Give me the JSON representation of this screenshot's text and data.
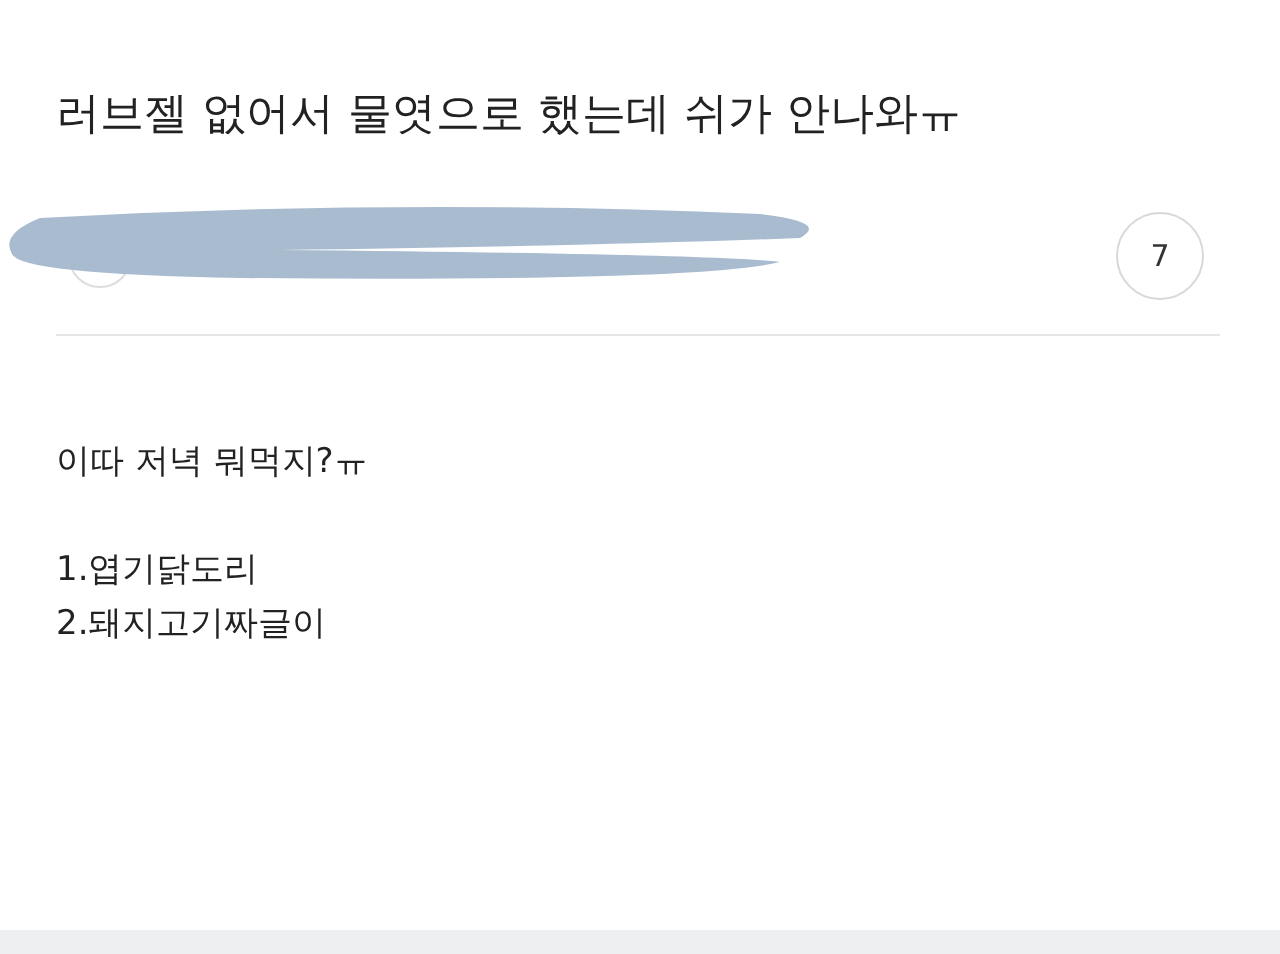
{
  "post": {
    "title": "러브젤 없어서 물엿으로 했는데 쉬가 안나와ㅠ",
    "comment_count": "7",
    "paragraphs": [
      [
        "이따 저녁 뭐먹지?ㅠ"
      ],
      [
        "1.엽기닭도리",
        "2.돼지고기짜글이"
      ]
    ]
  }
}
